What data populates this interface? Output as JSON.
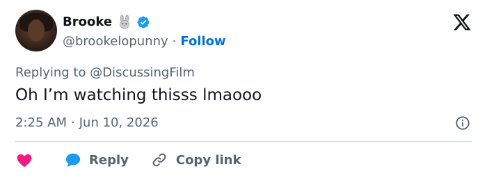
{
  "author": {
    "name": "Brooke",
    "handle": "@brookelopunny",
    "follow_label": "Follow",
    "separator": "·"
  },
  "reply_context": {
    "text": "Replying to @DiscussingFilm"
  },
  "tweet": {
    "text": "Oh I’m watching thisss lmaooo",
    "time": "2:25 AM",
    "date": "Jun 10, 2026",
    "separator": "·"
  },
  "actions": {
    "reply_label": "Reply",
    "copy_link_label": "Copy link"
  },
  "icons": {
    "brand": "x-logo-icon",
    "verified": "verified-badge-icon",
    "rabbit": "rabbit-emoji-icon",
    "info": "info-icon",
    "like": "heart-icon",
    "reply": "reply-bubble-icon",
    "copy": "link-icon"
  },
  "colors": {
    "accent": "#006fd6",
    "verified": "#1d9bf0",
    "like": "#f91880",
    "text_primary": "#0f1419",
    "text_secondary": "#536471",
    "divider": "#cfd9de"
  }
}
